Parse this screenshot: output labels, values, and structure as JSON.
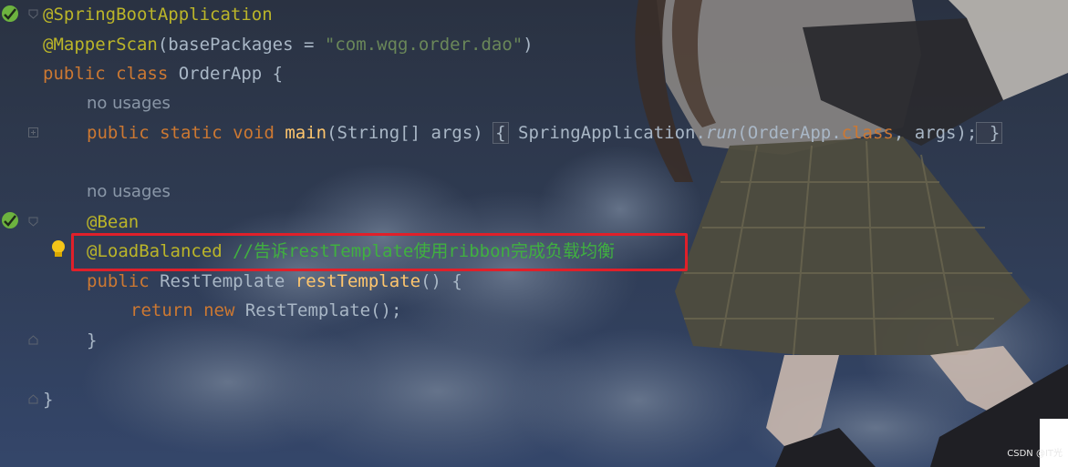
{
  "editor": {
    "lines": [
      {
        "annotation": "@SpringBootApplication"
      },
      {
        "annotation": "@MapperScan",
        "open": "(basePackages = ",
        "string": "\"com.wqg.order.dao\"",
        "close": ")"
      },
      {
        "kw": "public class ",
        "name": "OrderApp {"
      },
      {
        "hint": "no usages"
      },
      {
        "kw": "public static void ",
        "fn": "main",
        "params": "(String[] args) ",
        "fold_open": "{",
        "body_pre": " SpringApplication.",
        "italic": "run",
        "body_mid": "(OrderApp.",
        "kw2": "class",
        "body_post": ", args);",
        "fold_close": " }"
      },
      {
        "hint": "no usages"
      },
      {
        "annotation": "@Bean"
      },
      {
        "annotation": "@LoadBalanced",
        "comment_pre": " //",
        "comment_cn1": "告诉",
        "comment_mid": "restTemplate",
        "comment_cn2": "使用",
        "comment_mid2": "ribbon",
        "comment_cn3": "完成负载均衡"
      },
      {
        "kw": "public ",
        "type": "RestTemplate ",
        "fn": "restTemplate",
        "rest": "() {"
      },
      {
        "kw": "return new ",
        "rest": "RestTemplate();"
      },
      {
        "brace": "}"
      },
      {
        "brace": "}"
      }
    ]
  },
  "icons": {
    "spring_bean_1": "spring-bean-icon",
    "spring_bean_2": "spring-bean-icon",
    "bulb": "lightbulb-icon"
  },
  "colors": {
    "keyword": "#cc7832",
    "annotation": "#bbb529",
    "string": "#6a8759",
    "function": "#ffc66d",
    "comment": "#40b040",
    "highlight_border": "#e0202a"
  },
  "watermark": "CSDN @IT光"
}
